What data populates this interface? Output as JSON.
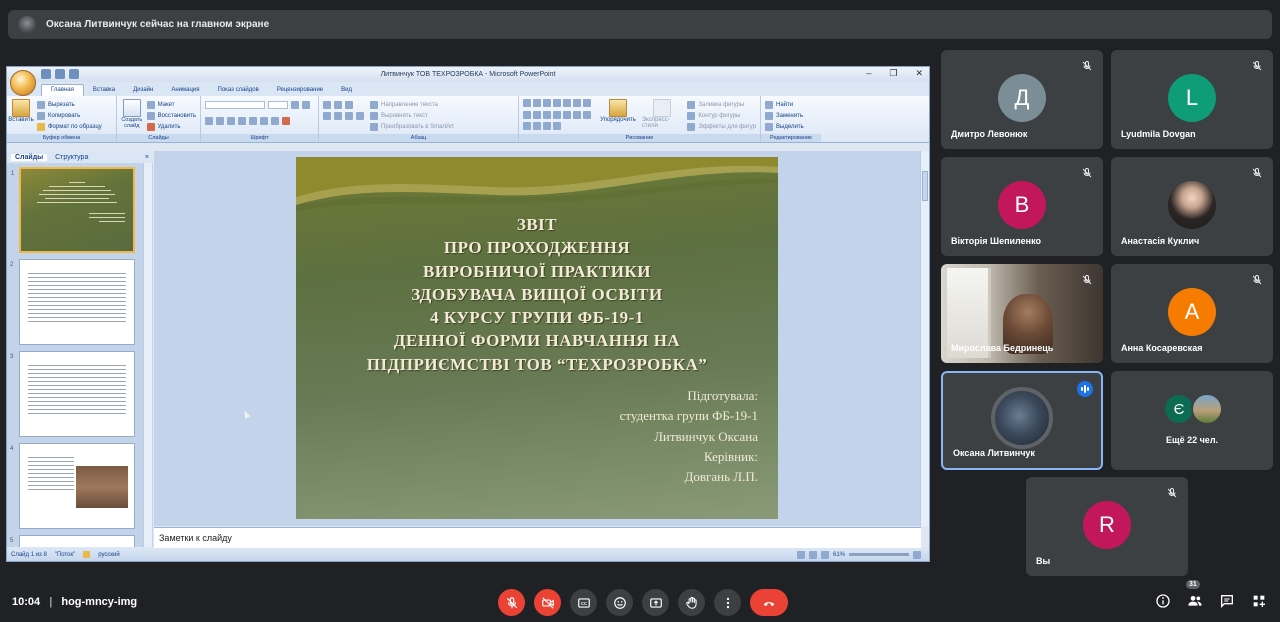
{
  "banner": {
    "text": "Оксана Литвинчук сейчас на главном экране"
  },
  "ppt": {
    "window_title": "Литвинчук ТОВ ТЕХРОЗРОБКА - Microsoft PowerPoint",
    "tabs": [
      "Главная",
      "Вставка",
      "Дизайн",
      "Анимация",
      "Показ слайдов",
      "Рецензирование",
      "Вид"
    ],
    "clipboard": {
      "paste": "Вставить",
      "cut": "Вырезать",
      "copy": "Копировать",
      "format": "Формат по образцу",
      "label": "Буфер обмена"
    },
    "slides": {
      "create": "Создать слайд",
      "layout": "Макет",
      "restore": "Восстановить",
      "delete": "Удалить",
      "label": "Слайды"
    },
    "font": {
      "label": "Шрифт"
    },
    "paragraph": {
      "direction": "Направление текста",
      "align": "Выровнять текст",
      "smartart": "Преобразовать в SmartArt",
      "label": "Абзац"
    },
    "drawing": {
      "arrange": "Упорядочить",
      "styles": "Экспресс-стили",
      "fill": "Заливка фигуры",
      "outline": "Контур фигуры",
      "effects": "Эффекты для фигур",
      "label": "Рисование"
    },
    "editing": {
      "find": "Найти",
      "replace": "Заменить",
      "select": "Выделить",
      "label": "Редактирование"
    },
    "pane_tabs": {
      "slides": "Слайды",
      "outline": "Структура"
    },
    "slide": {
      "heading_lines": [
        "ЗВІТ",
        "ПРО ПРОХОДЖЕННЯ",
        "ВИРОБНИЧОЇ ПРАКТИКИ",
        "ЗДОБУВАЧА ВИЩОЇ ОСВІТИ",
        "4 КУРСУ ГРУПИ ФБ-19-1",
        "ДЕННОЇ ФОРМИ НАВЧАННЯ НА",
        "ПІДПРИЄМСТВІ ТОВ “ТЕХРОЗРОБКА”"
      ],
      "info_lines": [
        "Підготувала:",
        "студентка групи ФБ-19-1",
        "Литвинчук Оксана",
        "Керівник:",
        "Довгань Л.П."
      ]
    },
    "notes_placeholder": "Заметки к слайду",
    "status": {
      "slide": "Слайд 1 из 8",
      "theme": "\"Поток\"",
      "lang": "русский",
      "zoom": "61%"
    }
  },
  "participants": [
    {
      "name": "Дмитро Левонюк",
      "initial": "Д",
      "color": "#7b8e98",
      "muted": true
    },
    {
      "name": "Lyudmila Dovgan",
      "initial": "L",
      "color": "#0f9d77",
      "muted": true
    },
    {
      "name": "Вікторія Шепиленко",
      "initial": "В",
      "color": "#c2185b",
      "muted": true
    },
    {
      "name": "Анастасія Куклич",
      "initial": "",
      "color": "#ffffff",
      "muted": true
    },
    {
      "name": "Мирослава Бедринець",
      "initial": "",
      "color": "",
      "muted": true
    },
    {
      "name": "Анна Косаревская",
      "initial": "А",
      "color": "#f57c00",
      "muted": true
    },
    {
      "name": "Оксана Литвинчук",
      "initial": "",
      "color": "",
      "muted": false
    },
    {
      "name": "Ещё 22 чел.",
      "initial": "Є",
      "color": "#0b6b53",
      "muted": false
    },
    {
      "name": "Вы",
      "initial": "R",
      "color": "#c2185b",
      "muted": true
    }
  ],
  "bottom": {
    "time": "10:04",
    "meeting_code": "hog-mncy-img",
    "people_count": "31"
  }
}
